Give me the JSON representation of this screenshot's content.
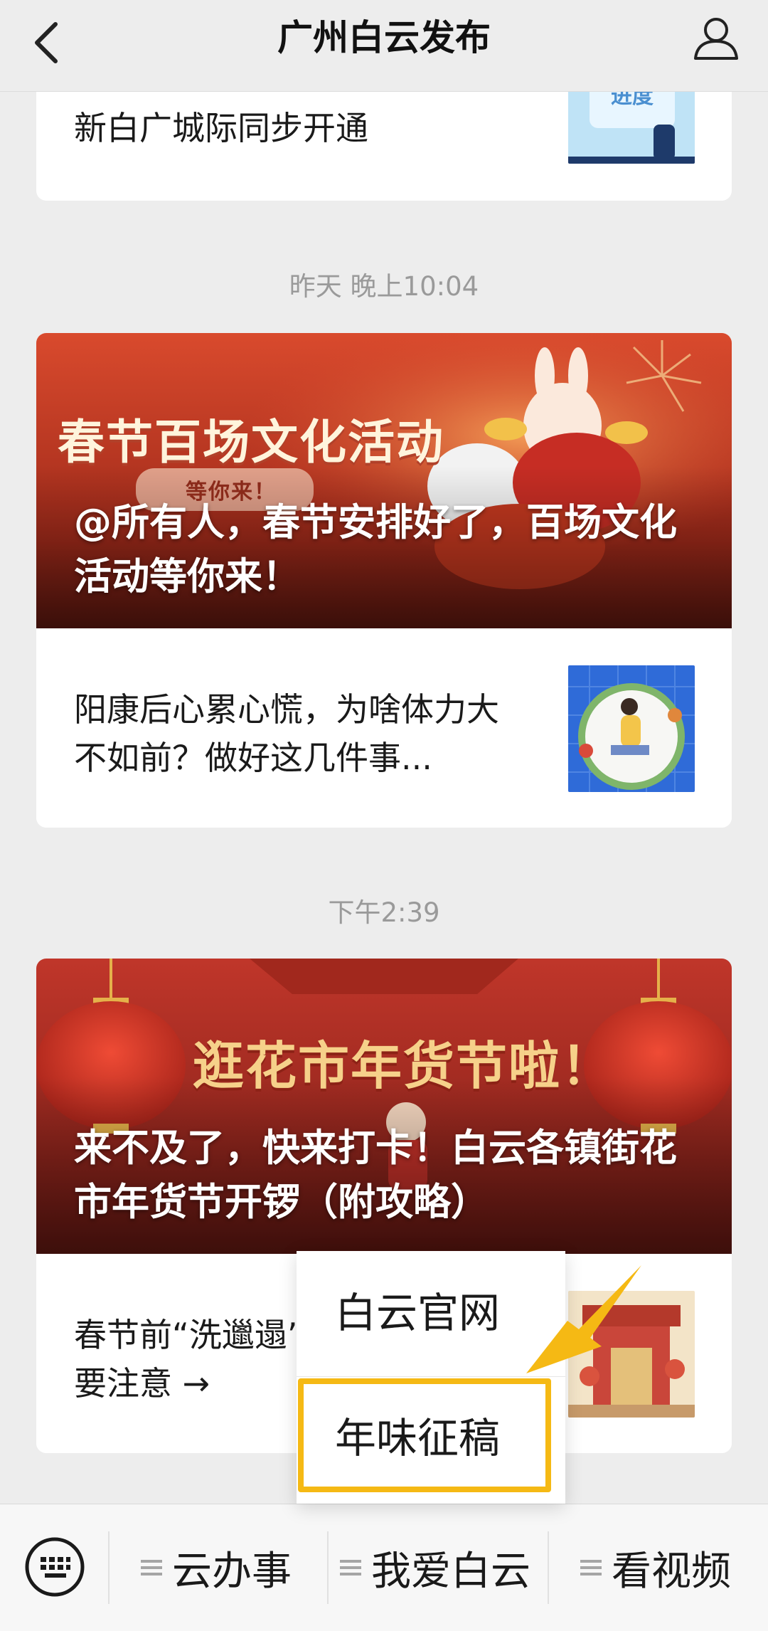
{
  "header": {
    "title": "广州白云发布"
  },
  "feed": {
    "item_top": {
      "text_line_partial": "…… 新白广城际同步开通",
      "text": "新白广城际同步开通"
    },
    "timestamp_1": "昨天 晚上10:04",
    "card_1": {
      "banner_art_title": "春节百场文化活动",
      "banner_art_sub": "等你来！",
      "title": "@所有人，春节安排好了，百场文化活动等你来！",
      "row_text": "阳康后心累心慌，为啥体力大不如前？做好这几件事..."
    },
    "timestamp_2": "下午2:39",
    "card_2": {
      "banner_art_title": "逛花市年货节啦！",
      "title": "来不及了，快来打卡！白云各镇街花市年货节开锣（附攻略）",
      "row_text_line1": "春节前“洗邋遢”",
      "row_text_line2": "要注意 →"
    }
  },
  "popup": {
    "items": [
      {
        "label": "白云官网"
      },
      {
        "label": "年味征稿"
      }
    ],
    "highlight_color": "#f5b914"
  },
  "menubar": {
    "items": [
      {
        "label": "云办事"
      },
      {
        "label": "我爱白云"
      },
      {
        "label": "看视频"
      }
    ]
  },
  "icons": {
    "back": "chevron-left-icon",
    "user": "user-icon",
    "keyboard": "keyboard-icon",
    "menu": "hamburger-icon"
  },
  "colors": {
    "banner_red": "#b8321f",
    "accent_gold": "#f5b914"
  }
}
